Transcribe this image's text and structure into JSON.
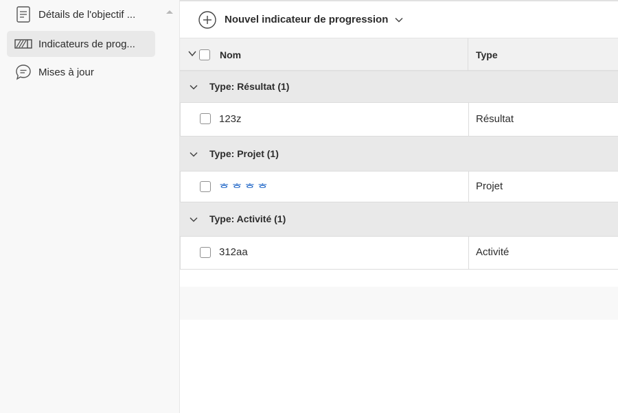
{
  "sidebar": {
    "items": [
      {
        "label": "Détails de l'objectif ...",
        "icon": "document-icon",
        "active": false
      },
      {
        "label": "Indicateurs de prog...",
        "icon": "progress-indicator-icon",
        "active": true
      },
      {
        "label": "Mises à jour",
        "icon": "comment-bubble-icon",
        "active": false
      }
    ]
  },
  "toolbar": {
    "add_label": "Nouvel indicateur de progression"
  },
  "table": {
    "headers": {
      "name": "Nom",
      "type": "Type"
    },
    "groups": [
      {
        "label": "Type: Résultat (1)",
        "rows": [
          {
            "name": "123z",
            "type": "Résultat",
            "link": false
          }
        ]
      },
      {
        "label": "Type: Projet (1)",
        "rows": [
          {
            "name": "ᄒᄒᄒᄒ",
            "type": "Projet",
            "link": true
          }
        ]
      },
      {
        "label": "Type: Activité (1)",
        "rows": [
          {
            "name": "312aa",
            "type": "Activité",
            "link": false
          }
        ]
      }
    ]
  },
  "colors": {
    "link": "#1b63c6",
    "group_bg": "#e9e9e9",
    "header_bg": "#f1f1f1",
    "active_nav_bg": "#e9e9e9"
  }
}
